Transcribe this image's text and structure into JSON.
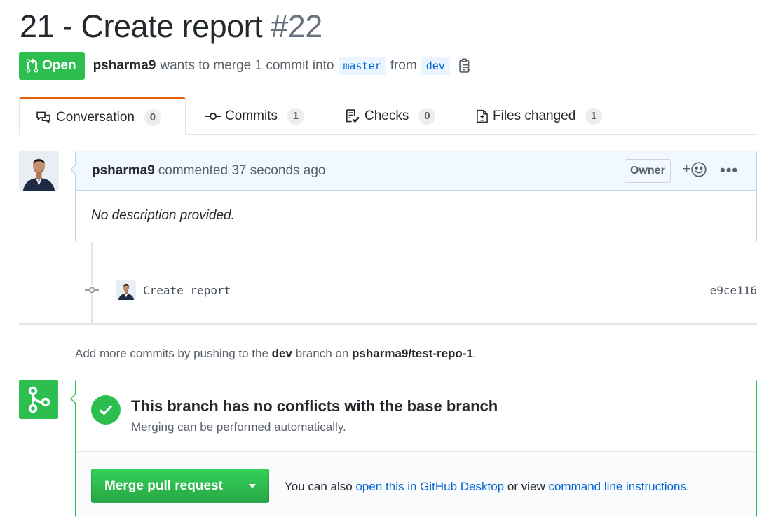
{
  "pr": {
    "title": "21 - Create report",
    "number": "#22",
    "state": "Open",
    "author": "psharma9",
    "merge_text_1": "wants to merge 1 commit into",
    "base_branch": "master",
    "from_text": "from",
    "head_branch": "dev"
  },
  "tabs": [
    {
      "label": "Conversation",
      "count": "0"
    },
    {
      "label": "Commits",
      "count": "1"
    },
    {
      "label": "Checks",
      "count": "0"
    },
    {
      "label": "Files changed",
      "count": "1"
    }
  ],
  "comment": {
    "author": "psharma9",
    "action": "commented 37 seconds ago",
    "role_label": "Owner",
    "reaction_plus": "+",
    "more": "•••",
    "body": "No description provided."
  },
  "commit": {
    "message": "Create report",
    "sha": "e9ce116"
  },
  "push_hint": {
    "prefix": "Add more commits by pushing to the",
    "branch": "dev",
    "middle": "branch on",
    "repo": "psharma9/test-repo-1",
    "suffix": "."
  },
  "merge": {
    "status_title": "This branch has no conflicts with the base branch",
    "status_sub": "Merging can be performed automatically.",
    "button_label": "Merge pull request",
    "alt_prefix": "You can also",
    "desktop_link": "open this in GitHub Desktop",
    "alt_middle": "or view",
    "cli_link": "command line instructions",
    "alt_suffix": "."
  },
  "colors": {
    "accent_green": "#2cbe4e",
    "link_blue": "#0366d6",
    "tab_selected_border": "#e36209"
  }
}
